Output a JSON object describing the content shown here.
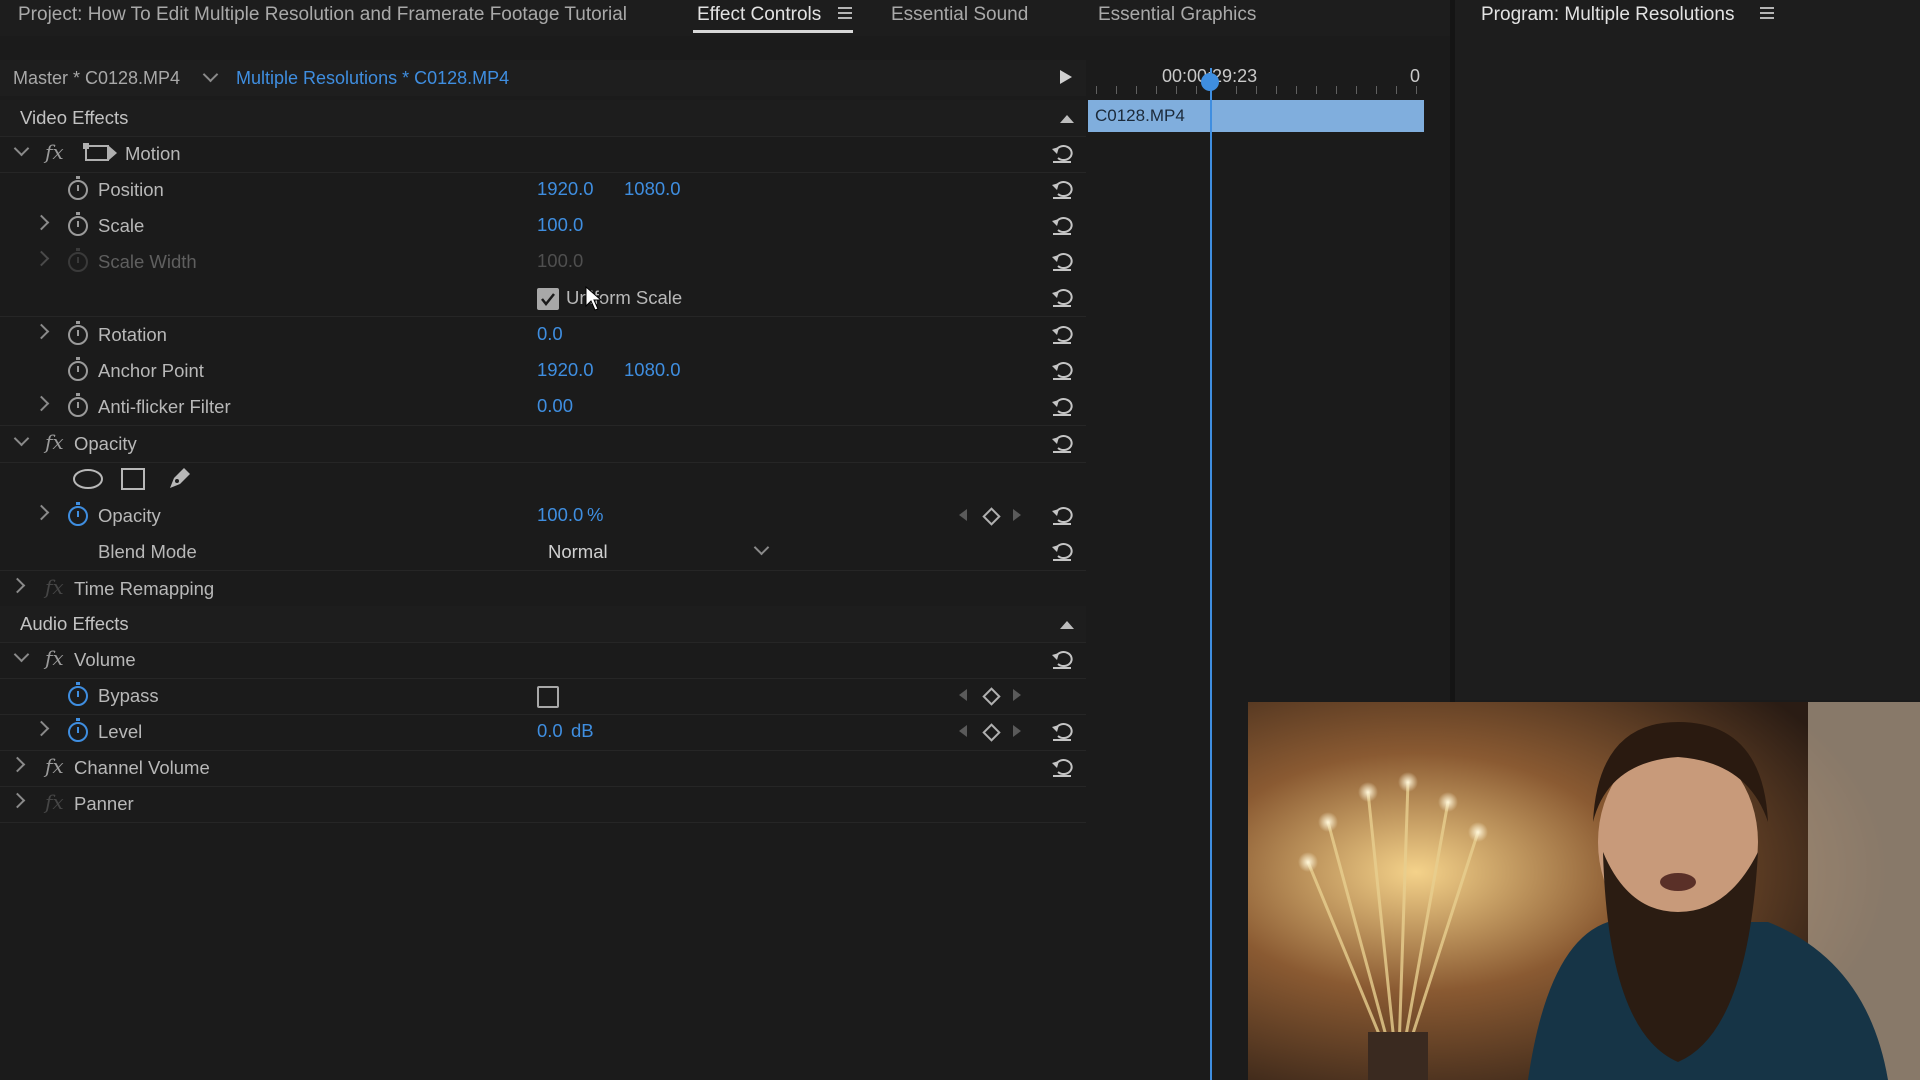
{
  "topbar": {
    "project_title": "Project: How To Edit Multiple Resolution and Framerate Footage Tutorial",
    "tab_effect_controls": "Effect Controls",
    "tab_essential_sound": "Essential Sound",
    "tab_essential_graphics": "Essential Graphics",
    "program_title": "Program: Multiple Resolutions"
  },
  "source": {
    "master": "Master * C0128.MP4",
    "sequence": "Multiple Resolutions * C0128.MP4"
  },
  "video_effects": {
    "header": "Video Effects",
    "motion": {
      "label": "Motion",
      "position": {
        "label": "Position",
        "x": "1920.0",
        "y": "1080.0"
      },
      "scale": {
        "label": "Scale",
        "value": "100.0"
      },
      "scale_width": {
        "label": "Scale Width",
        "value": "100.0"
      },
      "uniform_scale": {
        "label": "Uniform Scale",
        "checked": true
      },
      "rotation": {
        "label": "Rotation",
        "value": "0.0"
      },
      "anchor_point": {
        "label": "Anchor Point",
        "x": "1920.0",
        "y": "1080.0"
      },
      "anti_flicker": {
        "label": "Anti-flicker Filter",
        "value": "0.00"
      }
    },
    "opacity": {
      "label": "Opacity",
      "opacity_prop": {
        "label": "Opacity",
        "value": "100.0",
        "unit": "%"
      },
      "blend_mode": {
        "label": "Blend Mode",
        "value": "Normal"
      }
    },
    "time_remapping": {
      "label": "Time Remapping"
    }
  },
  "audio_effects": {
    "header": "Audio Effects",
    "volume": {
      "label": "Volume",
      "bypass": {
        "label": "Bypass",
        "checked": false
      },
      "level": {
        "label": "Level",
        "value": "0.0",
        "unit": "dB"
      }
    },
    "channel_volume": {
      "label": "Channel Volume"
    },
    "panner": {
      "label": "Panner"
    }
  },
  "timeline": {
    "timecode": "00:00:29:23",
    "timecode_next": "0",
    "clip_name": "C0128.MP4"
  },
  "colors": {
    "accent_blue": "#3f8ee0",
    "clip_blue": "#80aedd",
    "panel_bg": "#1b1b1b"
  }
}
